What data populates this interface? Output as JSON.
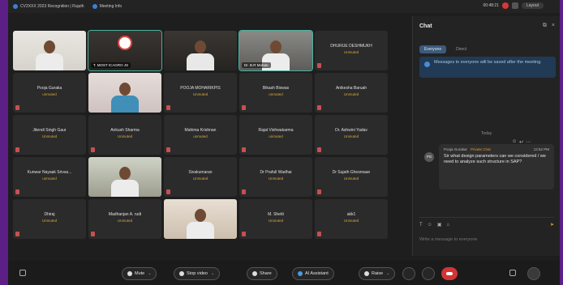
{
  "titlebar": {
    "items": [
      "CV2XXX 2023 Recognition | Rujuth",
      "Meeting Info"
    ],
    "timer": "00:48:21",
    "layout_label": "Layout"
  },
  "participants": [
    {
      "name": "",
      "sub": "",
      "video": "white",
      "label": ""
    },
    {
      "name": "",
      "sub": "",
      "video": "logo",
      "label": "T. MOST ICAGRO JS",
      "active": true
    },
    {
      "name": "",
      "sub": "",
      "video": "dark",
      "label": ""
    },
    {
      "name": "",
      "sub": "",
      "video": "room",
      "label": "Dr. B.R Mohan",
      "active": true
    },
    {
      "name": "DHURUE DESHMUKH",
      "sub": "Unmuted",
      "video": "none"
    },
    {
      "name": "Pooja Guraka",
      "sub": "unmuted",
      "video": "none"
    },
    {
      "name": "",
      "sub": "",
      "video": "pink",
      "label": ""
    },
    {
      "name": "POOJA MOHARIKPIS",
      "sub": "Unmuted",
      "video": "none"
    },
    {
      "name": "Bikash Biswas",
      "sub": "unmuted",
      "video": "none"
    },
    {
      "name": "Anikesha Baruah",
      "sub": "Unmuted",
      "video": "none"
    },
    {
      "name": "Jitendi Singh Gaur",
      "sub": "Unmuted",
      "video": "none"
    },
    {
      "name": "Ankush Sharma",
      "sub": "Unmuted",
      "video": "none"
    },
    {
      "name": "Mahima Krishnan",
      "sub": "unmuted",
      "video": "none"
    },
    {
      "name": "Rajat Vishwakarma",
      "sub": "unmuted",
      "video": "none"
    },
    {
      "name": "Dr. Ashwini Yadav",
      "sub": "Unmuted",
      "video": "none"
    },
    {
      "name": "Kunwar Nayaak Srivas...",
      "sub": "unmuted",
      "video": "none"
    },
    {
      "name": "",
      "sub": "",
      "video": "green",
      "label": ""
    },
    {
      "name": "Sivakumaran",
      "sub": "Unmuted",
      "video": "none"
    },
    {
      "name": "Dr Prafull Wadhai",
      "sub": "Unmuted",
      "video": "none"
    },
    {
      "name": "Dr Sujath Ghosmaan",
      "sub": "Unmuted",
      "video": "none"
    },
    {
      "name": "Dhiraj",
      "sub": "Unmuted",
      "video": "none"
    },
    {
      "name": "Madhanjan A. rudi",
      "sub": "Unmuted",
      "video": "none"
    },
    {
      "name": "",
      "sub": "",
      "video": "beige",
      "label": ""
    },
    {
      "name": "M. Shetti",
      "sub": "Unmuted",
      "video": "none"
    },
    {
      "name": "akk1",
      "sub": "Unmuted",
      "video": "none"
    }
  ],
  "chat": {
    "title": "Chat",
    "to_everyone": "Everyone",
    "to_direct": "Direct",
    "notice": "Messages to everyone will be saved after the meeting.",
    "date_sep": "Today",
    "message": {
      "avatar": "PG",
      "sender": "Pooja Gurakar",
      "tag": "Private Chat",
      "time": "12:52 PM",
      "body": "Sir what design parameters can we considered / we need to analyze such structure in SAP?"
    },
    "composer_placeholder": "Write a message to everyone"
  },
  "toolbar": {
    "mute": "Mute",
    "stop_video": "Stop video",
    "share": "Share",
    "ai_assistant": "AI Assistant",
    "raise": "Raise"
  }
}
